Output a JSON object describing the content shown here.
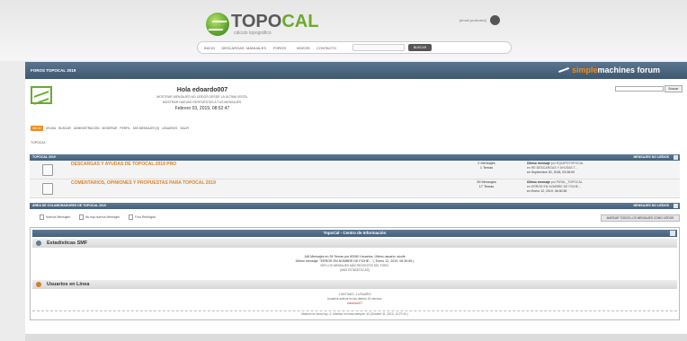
{
  "site": {
    "logo_title_a": "TOPO",
    "logo_title_b": "CAL",
    "logo_sub": "cálculo topográfico",
    "user_email": "[email protected]",
    "nav": [
      "INICIO",
      "DESCARGAS",
      "MANUALES",
      "FOROS",
      "VIDEOS",
      "CONTACTO"
    ],
    "search_button": "BUSCAR"
  },
  "forum": {
    "header_title": "FOROS TOPOCAL 2019",
    "smf_a": "simple",
    "smf_b": "machines forum",
    "greeting": "Hola edoardo007",
    "link1": "MOSTRAR MENSAJES NO LEÍDOS DESDE LA ÚLTIMA VISITA.",
    "link2": "MOSTRAR NUEVAS RESPUESTAS A TUS MENSAJES.",
    "date": "Febrero 03, 2019, 08:52:47",
    "search_button": "Buscar",
    "menu": [
      "INICIO",
      "AYUDA",
      "BUSCAR",
      "ADMINISTRACIÓN",
      "MODERAR",
      "PERFIL",
      "MIS MENSAJES [0]",
      "USUARIOS",
      "SALIR"
    ],
    "breadcrumb": "TOPOCAL"
  },
  "cat1": {
    "title": "TOPOCAL 2019",
    "unread": "MENSAJES NO LEÍDOS",
    "boards": [
      {
        "name": "DESCARGAS Y AYUDAS DE TOPOCAL 2019 PRO",
        "posts": "2 Mensajes",
        "topics": "1 Temas",
        "last_label": "Último mensaje",
        "last_by": "por EQUIPOTOPOCAL",
        "last_in": "en RE:DESCARGAS Y AYUDAS T...",
        "last_date": "en Septiembre 30, 2018, 03:38:09"
      },
      {
        "name": "COMENTARIOS, OPINIONES Y PROPUESTAS PARA TOPOCAL 2019",
        "posts": "39 Mensajes",
        "topics": "17 Temas",
        "last_label": "Último mensaje",
        "last_by": "por PATAL_TOPOCAL",
        "last_in": "en ERROR EN NOMBRE DE FICHE...",
        "last_date": "en Enero 12, 2019, 06:30:55"
      }
    ]
  },
  "cat2": {
    "title": "ÁREA DE COLABORADORES DE TOPOCAL 2019",
    "unread": "MENSAJES NO LEÍDOS"
  },
  "legend": [
    "Nuevos Mensajes",
    "No hay nuevos Mensajes",
    "Foro Redirigido"
  ],
  "mark_read": "MARCAR TODOS LOS MENSAJES COMO LEÍDOS",
  "centro": {
    "title": "TopoCal - Centro de Información",
    "stats_title": "Estadísticas SMF",
    "stats_line1": "146 Mensajes en 35 Temas por 82060 Usuarios. Último usuario: sicofe",
    "stats_line2": "Último mensaje: \"ERROR EN NOMBRE DE FICHE...\" ( Enero 12, 2019, 06:30:55 )",
    "stats_link1": "VER LOS MENSAJES MÁS RECIENTES DEL FORO.",
    "stats_link2": "[MÁS ESTADÍSTICAS]",
    "online_title": "Usuarios en Línea",
    "online_line1": "1 INVITADO, 1 USUARIO",
    "online_line2": "Usuarios activos en los últimos 15 minutos:",
    "online_user": "edoardo007",
    "online_max": "Máximo en línea hoy: 3. Máximo en línea siempre: 43 (Octubre 31, 2013, 12:27:44 )"
  }
}
